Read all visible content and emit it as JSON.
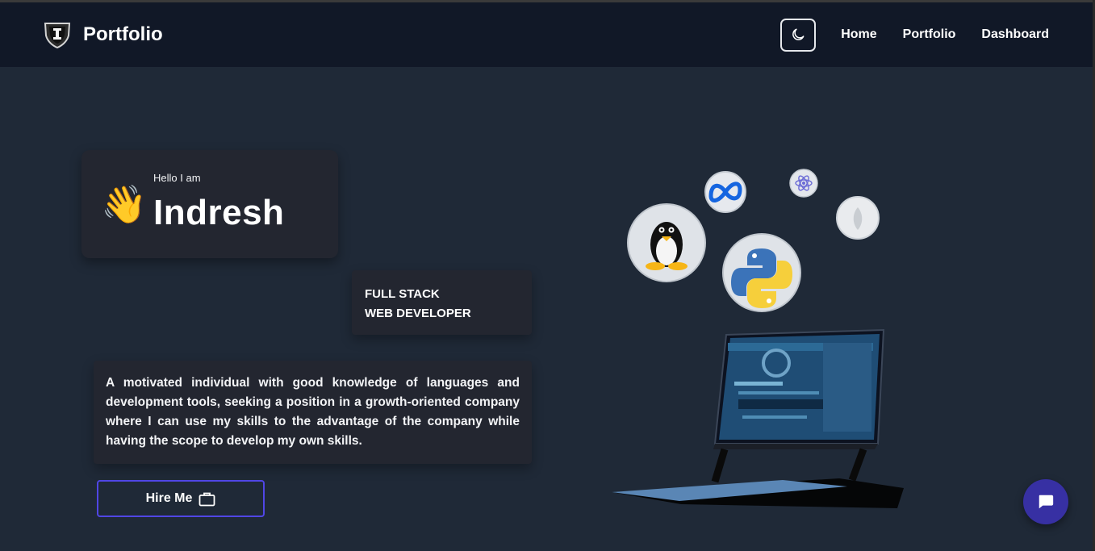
{
  "header": {
    "brand_title": "Portfolio",
    "nav": [
      {
        "label": "Home"
      },
      {
        "label": "Portfolio"
      },
      {
        "label": "Dashboard"
      }
    ]
  },
  "hero": {
    "greeting": "Hello I am",
    "wave_emoji": "👋",
    "name": "Indresh",
    "role_line1": "FULL STACK",
    "role_line2": "WEB DEVELOPER",
    "description": "A motivated individual with good knowledge of languages and development tools, seeking a position in a growth-oriented company where I can use my skills to the advantage of the company while having the scope to develop my own skills.",
    "hire_label": "Hire Me"
  },
  "icons": {
    "theme_toggle": "moon-icon",
    "hire": "briefcase-icon",
    "chat": "chat-bubble-icon",
    "logo": "shield-logo-icon",
    "tech": [
      "linux-penguin-icon",
      "meta-icon",
      "react-icon",
      "mongodb-icon",
      "python-icon"
    ]
  },
  "colors": {
    "page_bg": "#1f2937",
    "header_bg": "#111827",
    "card_bg": "#232630",
    "accent": "#5046e5",
    "chat_bg": "#3730a3"
  }
}
